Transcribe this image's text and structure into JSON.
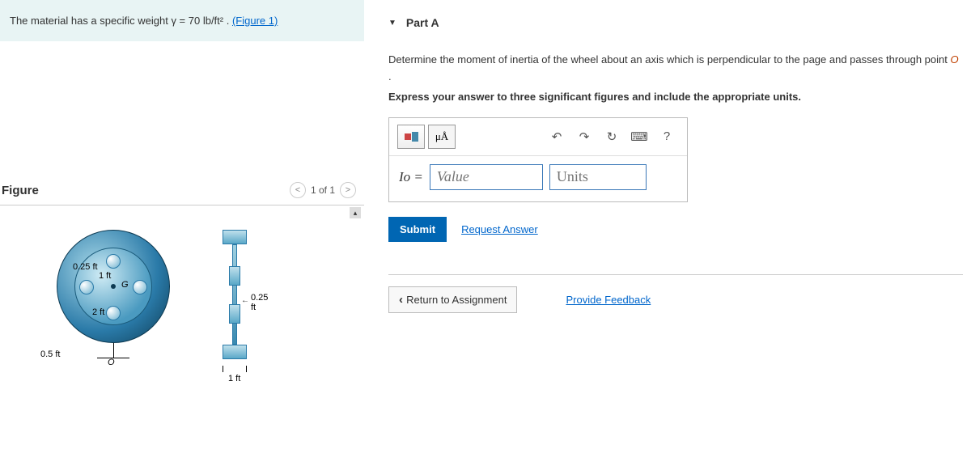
{
  "problem": {
    "text_prefix": "The material has a specific weight ",
    "gamma_expr": "γ = 70 lb/ft²",
    "text_suffix": ". ",
    "figure_link": "(Figure 1)"
  },
  "figure": {
    "title": "Figure",
    "counter": "1 of 1",
    "labels": {
      "r025": "0.25 ft",
      "r1": "1 ft",
      "r2": "2 ft",
      "r05": "0.5 ft",
      "G": "G",
      "O": "O",
      "side025": "0.25 ft",
      "bottom1": "1 ft"
    }
  },
  "part": {
    "label": "Part A",
    "instruction_line1": "Determine the moment of inertia of the wheel about an axis which is perpendicular to the page and passes through point ",
    "pointO": "O",
    "instruction_line1_end": ".",
    "instruction_line2": "Express your answer to three significant figures and include the appropriate units.",
    "toolbar": {
      "symbols": "μÅ",
      "help": "?"
    },
    "input": {
      "lhs": "Io =",
      "value_placeholder": "Value",
      "units_placeholder": "Units"
    },
    "submit": "Submit",
    "request": "Request Answer"
  },
  "nav": {
    "return": "Return to Assignment",
    "feedback": "Provide Feedback"
  }
}
